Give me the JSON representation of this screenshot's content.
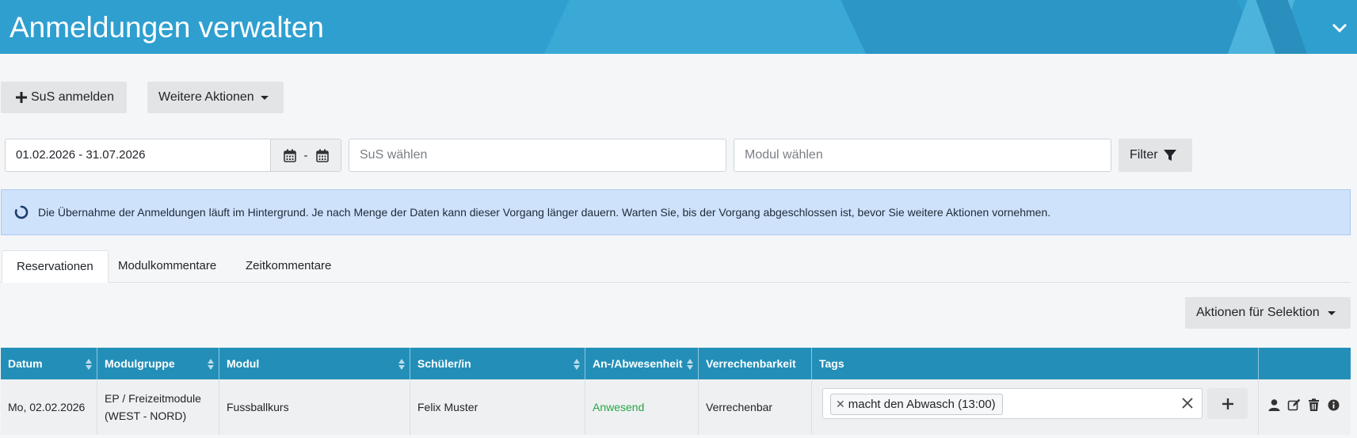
{
  "header": {
    "title": "Anmeldungen verwalten"
  },
  "toolbar": {
    "sus_anmelden": "SuS anmelden",
    "weitere_aktionen": "Weitere Aktionen"
  },
  "filters": {
    "date_range": "01.02.2026 - 31.07.2026",
    "date_separator": "-",
    "sus_placeholder": "SuS wählen",
    "modul_placeholder": "Modul wählen",
    "filter_label": "Filter"
  },
  "alert": {
    "text": "Die Übernahme der Anmeldungen läuft im Hintergrund. Je nach Menge der Daten kann dieser Vorgang länger dauern. Warten Sie, bis der Vorgang abgeschlossen ist, bevor Sie weitere Aktionen vornehmen."
  },
  "tabs": [
    {
      "label": "Reservationen",
      "active": true
    },
    {
      "label": "Modulkommentare",
      "active": false
    },
    {
      "label": "Zeitkommentare",
      "active": false
    }
  ],
  "selection_actions": "Aktionen für Selektion",
  "table": {
    "columns": [
      "Datum",
      "Modulgruppe",
      "Modul",
      "Schüler/in",
      "An-/Abwesenheit",
      "Verrechenbarkeit",
      "Tags",
      ""
    ],
    "rows": [
      {
        "datum": "Mo, 02.02.2026",
        "modulgruppe_1": "EP / Freizeitmodule",
        "modulgruppe_2": "(WEST - NORD)",
        "modul": "Fussballkurs",
        "schueler": "Felix Muster",
        "anwesenheit": "Anwesend",
        "verrechenbarkeit": "Verrechenbar",
        "tag": "macht den Abwasch (13:00)"
      }
    ]
  },
  "colors": {
    "header": "#2f9fd0",
    "table_header": "#238fb8",
    "alert_bg": "#cfe2fb",
    "present": "#28a745"
  },
  "icons": [
    "collapse-chevron-icon",
    "plus-icon",
    "calendar-icon",
    "filter-icon",
    "spinner-icon",
    "sort-icon",
    "user-icon",
    "edit-icon",
    "trash-icon",
    "info-icon"
  ]
}
